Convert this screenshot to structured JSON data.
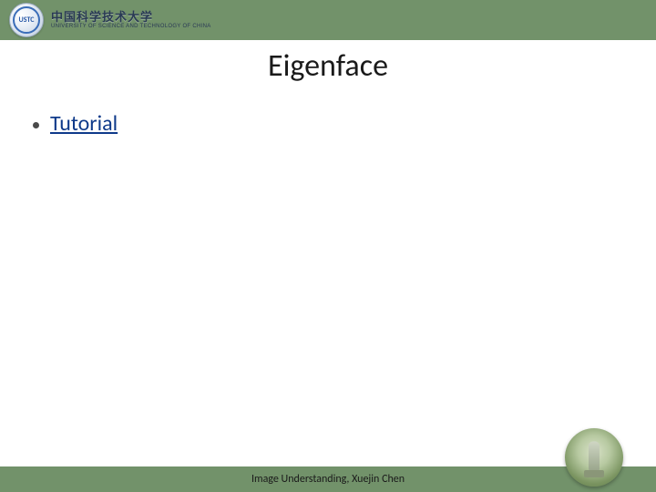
{
  "header": {
    "university_zh": "中国科学技术大学",
    "university_en": "UNIVERSITY OF SCIENCE AND TECHNOLOGY OF CHINA",
    "logo_abbr": "USTC"
  },
  "slide": {
    "title": "Eigenface",
    "bullets": [
      {
        "text": "Tutorial",
        "is_link": true
      }
    ]
  },
  "footer": {
    "text": "Image Understanding, Xuejin Chen"
  }
}
